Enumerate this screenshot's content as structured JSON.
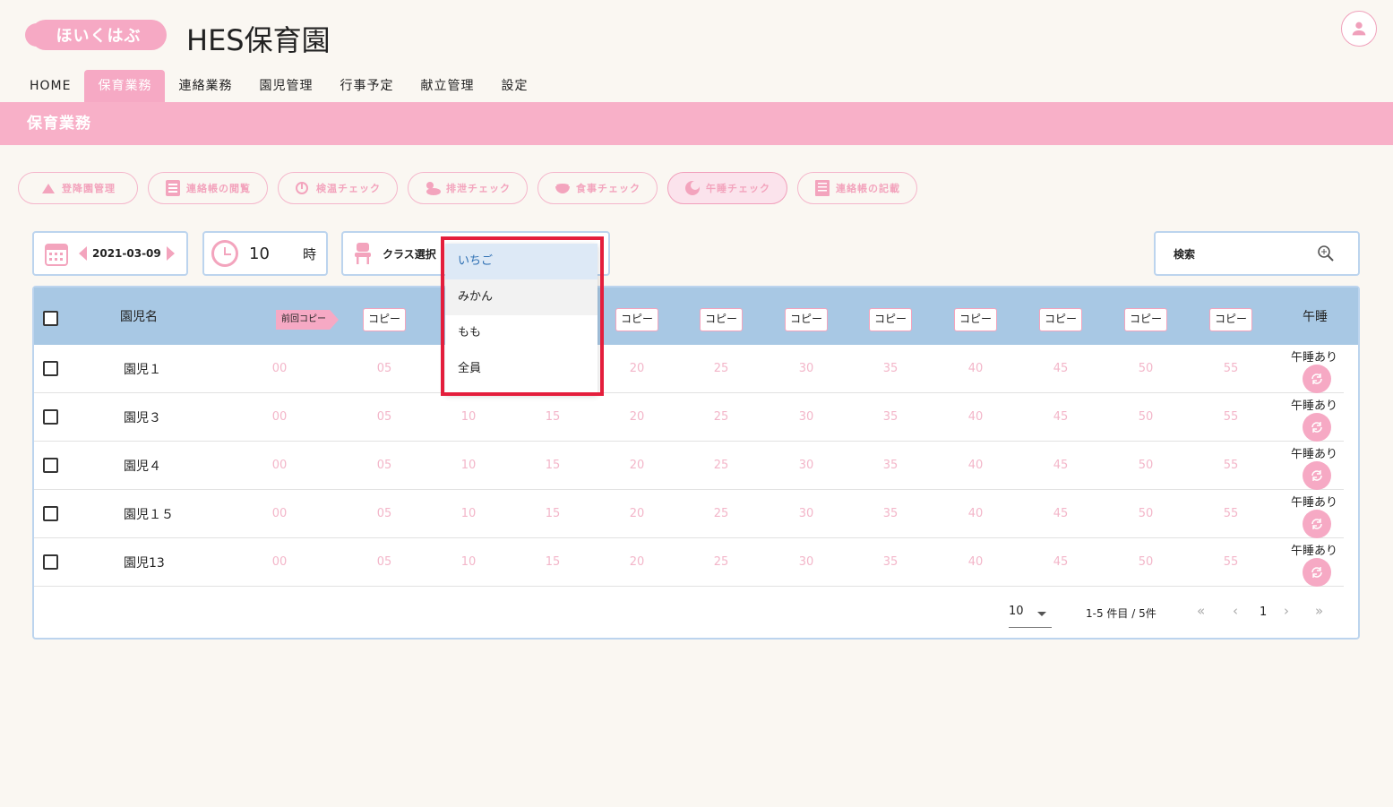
{
  "header": {
    "logo_text": "ほいくはぶ",
    "title": "HES保育園"
  },
  "nav": {
    "items": [
      {
        "label": "HOME",
        "active": false
      },
      {
        "label": "保育業務",
        "active": true
      },
      {
        "label": "連絡業務",
        "active": false
      },
      {
        "label": "園児管理",
        "active": false
      },
      {
        "label": "行事予定",
        "active": false
      },
      {
        "label": "献立管理",
        "active": false
      },
      {
        "label": "設定",
        "active": false
      }
    ]
  },
  "banner": {
    "title": "保育業務"
  },
  "actions": [
    {
      "label": "登降園管理",
      "icon": "bus-icon"
    },
    {
      "label": "連絡帳の閲覧",
      "icon": "list-icon"
    },
    {
      "label": "検温チェック",
      "icon": "thermometer-icon"
    },
    {
      "label": "排泄チェック",
      "icon": "duck-icon"
    },
    {
      "label": "食事チェック",
      "icon": "bowl-icon"
    },
    {
      "label": "午睡チェック",
      "icon": "sleep-icon",
      "active": true
    },
    {
      "label": "連絡帳の記載",
      "icon": "notebook-icon"
    }
  ],
  "controls": {
    "date": "2021-03-09",
    "hour": "10",
    "hour_unit": "時",
    "class_label": "クラス選択",
    "search_label": "検索"
  },
  "class_dropdown": {
    "options": [
      "いちご",
      "みかん",
      "もも",
      "全員"
    ],
    "selected": "いちご"
  },
  "table": {
    "col_name": "園児名",
    "prev_copy": "前回コピー",
    "copy_label": "コピー",
    "col_nap": "午睡",
    "slots": [
      "00",
      "05",
      "10",
      "15",
      "20",
      "25",
      "30",
      "35",
      "40",
      "45",
      "50",
      "55"
    ],
    "rows": [
      {
        "name": "園児１",
        "nap": "午睡あり"
      },
      {
        "name": "園児３",
        "nap": "午睡あり"
      },
      {
        "name": "園児４",
        "nap": "午睡あり"
      },
      {
        "name": "園児１５",
        "nap": "午睡あり"
      },
      {
        "name": "園児13",
        "nap": "午睡あり"
      }
    ]
  },
  "pagination": {
    "rows_per_page": "10",
    "range": "1-5 件目 / 5件",
    "page": "1"
  },
  "colors": {
    "accent": "#f6a9c4",
    "header_blue": "#a8c8e4",
    "highlight": "#e41e3c"
  }
}
